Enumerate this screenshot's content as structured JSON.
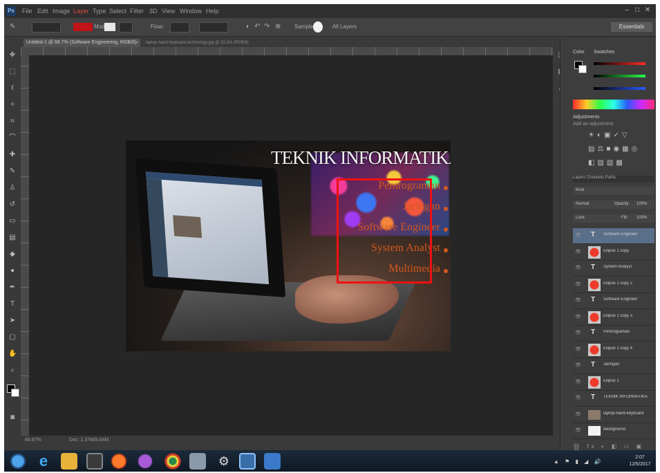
{
  "menubar": {
    "logo": "Ps",
    "items": [
      "File",
      "Edit",
      "Image",
      "Layer",
      "Type",
      "Select",
      "Filter",
      "3D",
      "View",
      "Window",
      "Help"
    ]
  },
  "optbar": {
    "mode_label": "Mode:",
    "size_label": "100",
    "flow_label": "Flow:",
    "flow_value": "100%",
    "sample_label": "Sample:",
    "sample_value": "All Layers",
    "workspace": "Essentials"
  },
  "doc": {
    "tab_label": "Untitled-1 @ 66.7% (Software Engineering, RGB/8)",
    "second_tab_label": "laptop-hand-keyboard-technology.jpg @ 33.3% (RGB/8)",
    "title": "TEKNIK INFORMATIKA",
    "lines": [
      "Pemrograman",
      "Jaringan",
      "Software Engineer",
      "System Analyst",
      "Multimedia"
    ]
  },
  "status": {
    "zoom": "66.67%",
    "doc_info": "Doc: 1.37M/8.64M"
  },
  "colors": {
    "selection_box": "#ee1111",
    "text_orange": "#d2581e",
    "fg": "#000000",
    "bg": "#ffffff"
  },
  "panels": {
    "color_tab": "Color",
    "swatches_tab": "Swatches",
    "adjust_tab": "Adjustments",
    "adjust_subtitle": "Add an adjustment",
    "layer_tabs": "Layers  Channels  Paths",
    "kind_label": "Kind",
    "blend_mode": "Normal",
    "opacity_label": "Opacity:",
    "opacity_value": "100%",
    "lock_label": "Lock:",
    "fill_label": "Fill:",
    "fill_value": "100%",
    "layers": [
      {
        "name": "Software Engineer",
        "thumb": "text",
        "selected": true
      },
      {
        "name": "Ellipse 1 copy",
        "thumb": "red"
      },
      {
        "name": "System Analyst",
        "thumb": "text"
      },
      {
        "name": "Ellipse 1 copy 2",
        "thumb": "red"
      },
      {
        "name": "Software Engineer",
        "thumb": "text"
      },
      {
        "name": "Ellipse 1 copy 3",
        "thumb": "red"
      },
      {
        "name": "Pemrograman",
        "thumb": "text"
      },
      {
        "name": "Ellipse 1 copy 4",
        "thumb": "red"
      },
      {
        "name": "Jaringan",
        "thumb": "text"
      },
      {
        "name": "Ellipse 1",
        "thumb": "red"
      },
      {
        "name": "TEKNIK INFORMATIKA",
        "thumb": "text"
      },
      {
        "name": "laptop-hand-keyboard",
        "thumb": "image"
      },
      {
        "name": "Background",
        "thumb": "white"
      }
    ]
  },
  "taskbar": {
    "clock_time": "2:07",
    "clock_date": "12/6/2017"
  }
}
